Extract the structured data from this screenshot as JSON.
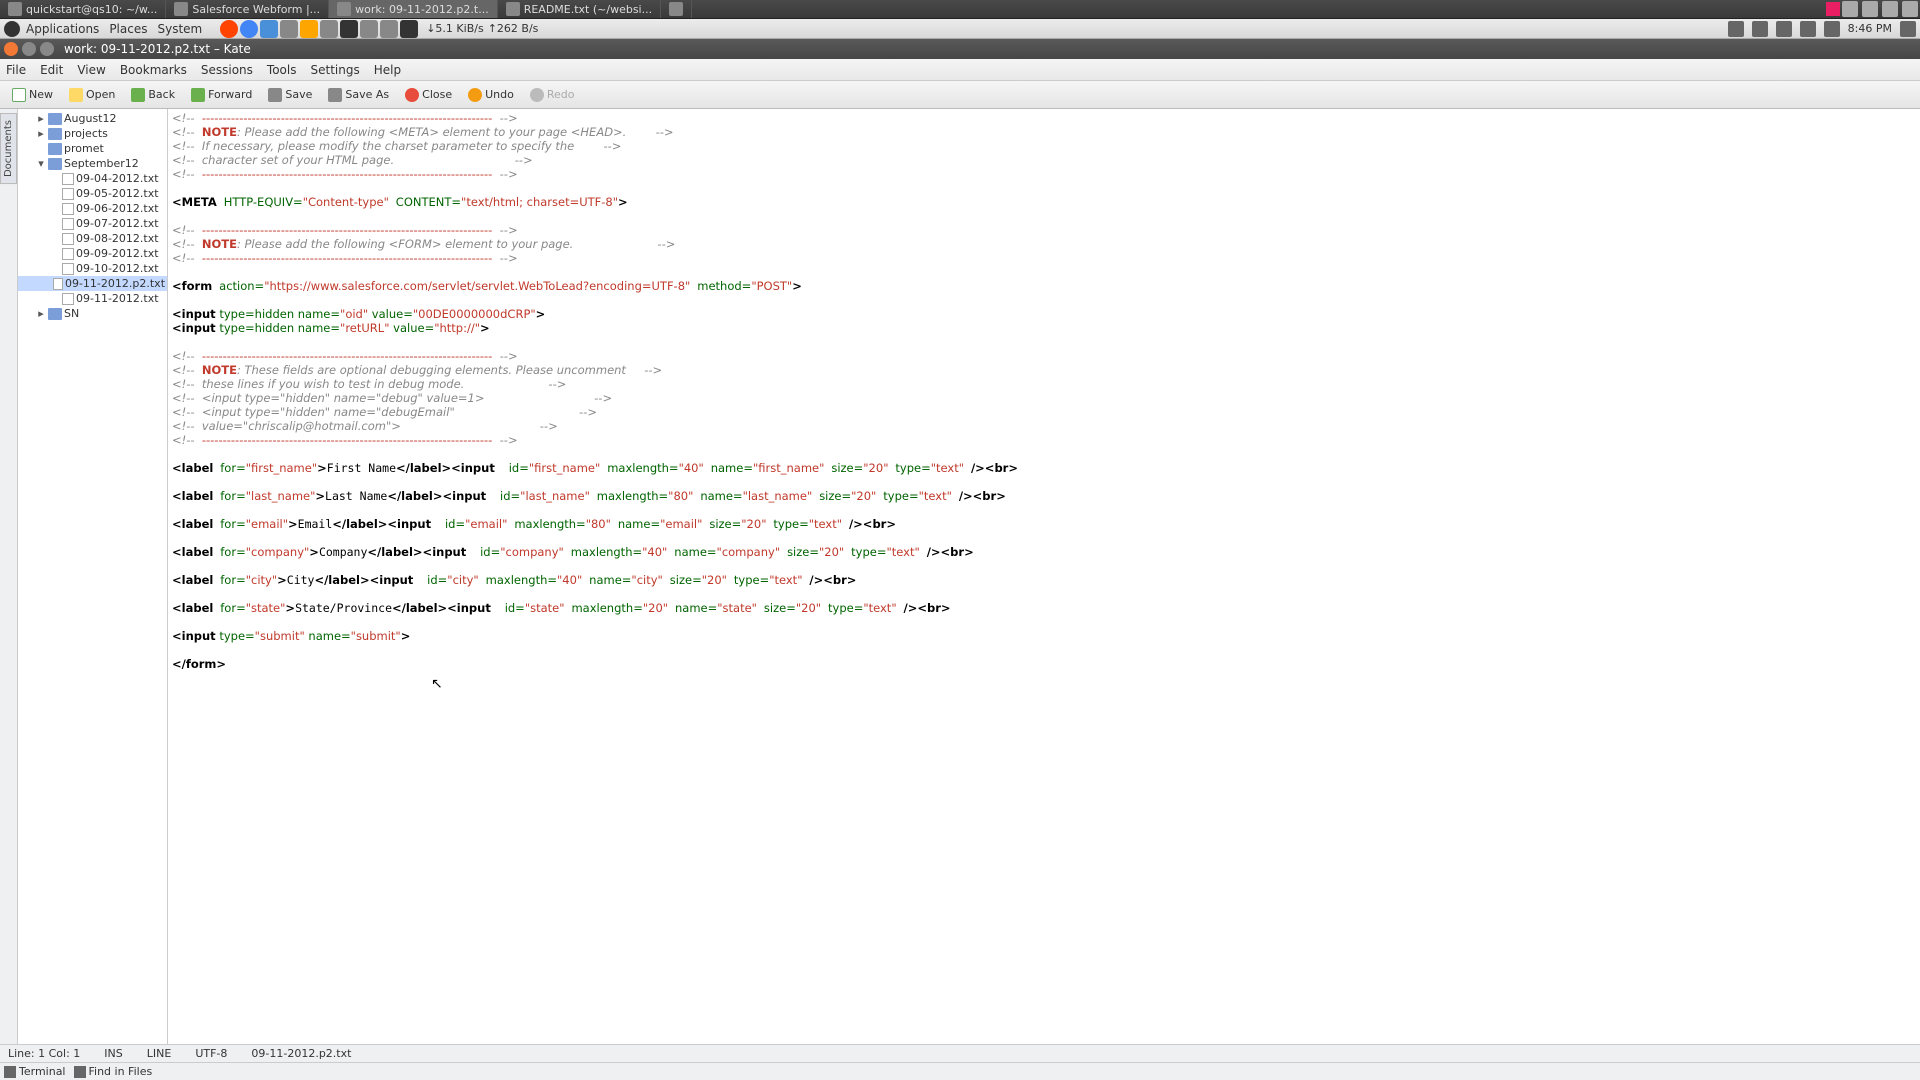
{
  "taskbar": {
    "tabs": [
      {
        "label": "quickstart@qs10: ~/w..."
      },
      {
        "label": "Salesforce Webform |..."
      },
      {
        "label": "work: 09-11-2012.p2.t..."
      },
      {
        "label": "README.txt (~/websi..."
      }
    ]
  },
  "syspanel": {
    "apps": "Applications",
    "places": "Places",
    "system": "System",
    "net_down": "↓5.1 KiB/s",
    "net_up": "↑262 B/s",
    "time": "8:46 PM"
  },
  "window": {
    "title": "work: 09-11-2012.p2.txt – Kate"
  },
  "menubar": [
    "File",
    "Edit",
    "View",
    "Bookmarks",
    "Sessions",
    "Tools",
    "Settings",
    "Help"
  ],
  "toolbar": {
    "new": "New",
    "open": "Open",
    "back": "Back",
    "forward": "Forward",
    "save": "Save",
    "saveas": "Save As",
    "close": "Close",
    "undo": "Undo",
    "redo": "Redo"
  },
  "side_vtab": "Documents",
  "tree": [
    {
      "type": "folder",
      "label": "August12",
      "depth": 1,
      "expander": "▸"
    },
    {
      "type": "folder",
      "label": "projects",
      "depth": 1,
      "expander": "▸"
    },
    {
      "type": "folder",
      "label": "promet",
      "depth": 1,
      "expander": ""
    },
    {
      "type": "folder",
      "label": "September12",
      "depth": 1,
      "expander": "▾"
    },
    {
      "type": "file",
      "label": "09-04-2012.txt",
      "depth": 2,
      "sel": false
    },
    {
      "type": "file",
      "label": "09-05-2012.txt",
      "depth": 2,
      "sel": false
    },
    {
      "type": "file",
      "label": "09-06-2012.txt",
      "depth": 2,
      "sel": false
    },
    {
      "type": "file",
      "label": "09-07-2012.txt",
      "depth": 2,
      "sel": false
    },
    {
      "type": "file",
      "label": "09-08-2012.txt",
      "depth": 2,
      "sel": false
    },
    {
      "type": "file",
      "label": "09-09-2012.txt",
      "depth": 2,
      "sel": false
    },
    {
      "type": "file",
      "label": "09-10-2012.txt",
      "depth": 2,
      "sel": false
    },
    {
      "type": "file",
      "label": "09-11-2012.p2.txt",
      "depth": 2,
      "sel": true
    },
    {
      "type": "file",
      "label": "09-11-2012.txt",
      "depth": 2,
      "sel": false
    },
    {
      "type": "folder",
      "label": "SN",
      "depth": 1,
      "expander": "▸"
    }
  ],
  "editor": {
    "dashes": "----------------------------------------------------------------------",
    "note": "NOTE",
    "meta_note1": ": Please add the following <META> element to your page <HEAD>.",
    "meta_note2": "If necessary, please modify the charset parameter to specify the",
    "meta_note3": "character set of your HTML page.",
    "meta_line": {
      "tag": "META",
      "a1": "HTTP-EQUIV=",
      "v1": "\"Content-type\"",
      "a2": "CONTENT=",
      "v2": "\"text/html; charset=UTF-8\""
    },
    "form_note": ": Please add the following <FORM> element to your page.",
    "form_line": {
      "tag": "form",
      "a1": "action=",
      "v1": "\"https://www.salesforce.com/servlet/servlet.WebToLead?encoding=UTF-8\"",
      "a2": "method=",
      "v2": "\"POST\""
    },
    "hidden1": {
      "tag": "input",
      "rest": " type=hidden name=",
      "n": "\"oid\"",
      "vattr": " value=",
      "v": "\"00DE0000000dCRP\""
    },
    "hidden2": {
      "tag": "input",
      "rest": " type=hidden name=",
      "n": "\"retURL\"",
      "vattr": " value=",
      "v": "\"http://\""
    },
    "debug_note1": ": These fields are optional debugging elements. Please uncomment",
    "debug_note2": "these lines if you wish to test in debug mode.",
    "debug_l1": "<input type=\"hidden\" name=\"debug\" value=1>",
    "debug_l2": "<input type=\"hidden\" name=\"debugEmail\"",
    "debug_l3": "value=\"chriscalip@hotmail.com\">",
    "labels": [
      {
        "for": "\"first_name\"",
        "text": "First Name",
        "id": "\"first_name\"",
        "max": "\"40\"",
        "name": "\"first_name\"",
        "size": "\"20\"",
        "type": "\"text\""
      },
      {
        "for": "\"last_name\"",
        "text": "Last Name",
        "id": "\"last_name\"",
        "max": "\"80\"",
        "name": "\"last_name\"",
        "size": "\"20\"",
        "type": "\"text\""
      },
      {
        "for": "\"email\"",
        "text": "Email",
        "id": "\"email\"",
        "max": "\"80\"",
        "name": "\"email\"",
        "size": "\"20\"",
        "type": "\"text\""
      },
      {
        "for": "\"company\"",
        "text": "Company",
        "id": "\"company\"",
        "max": "\"40\"",
        "name": "\"company\"",
        "size": "\"20\"",
        "type": "\"text\""
      },
      {
        "for": "\"city\"",
        "text": "City",
        "id": "\"city\"",
        "max": "\"40\"",
        "name": "\"city\"",
        "size": "\"20\"",
        "type": "\"text\""
      },
      {
        "for": "\"state\"",
        "text": "State/Province",
        "id": "\"state\"",
        "max": "\"20\"",
        "name": "\"state\"",
        "size": "\"20\"",
        "type": "\"text\""
      }
    ],
    "submit": {
      "tag": "input",
      "a": " type=",
      "v1": "\"submit\"",
      "b": " name=",
      "v2": "\"submit\""
    },
    "form_close": "</form>",
    "cmt_open": "<!--  ",
    "cmt_close": "  -->"
  },
  "status": {
    "line": "Line: 1 Col: 1",
    "ins": "INS",
    "mode": "LINE",
    "enc": "UTF-8",
    "file": "09-11-2012.p2.txt"
  },
  "bottom": {
    "terminal": "Terminal",
    "find": "Find in Files"
  }
}
